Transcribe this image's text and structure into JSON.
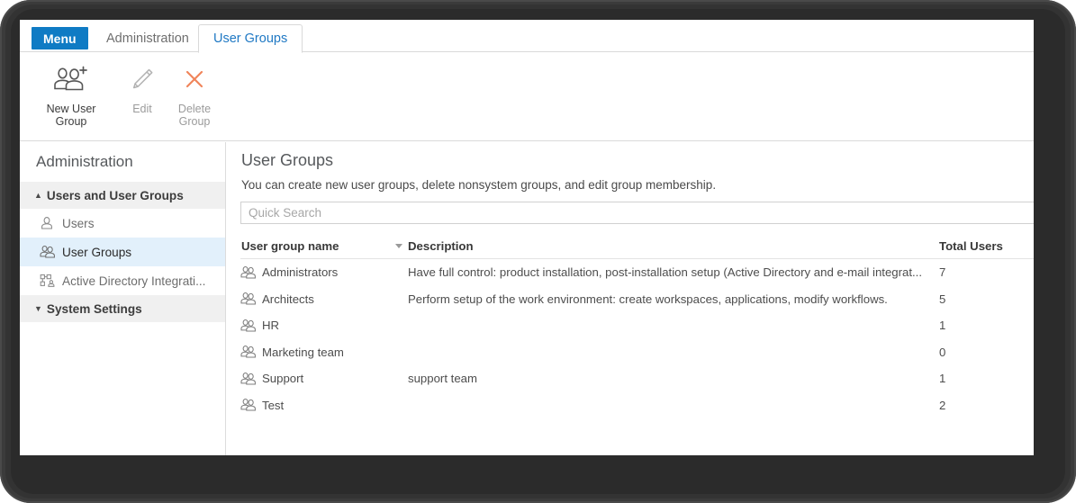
{
  "window": {
    "tabs": [
      {
        "id": "menu",
        "label": "Menu",
        "state": "button"
      },
      {
        "id": "administration",
        "label": "Administration",
        "state": "inactive"
      },
      {
        "id": "usergroups",
        "label": "User Groups",
        "state": "active"
      }
    ]
  },
  "ribbon": {
    "buttons": [
      {
        "id": "new-user-group",
        "label": "New User\nGroup",
        "icon": "add-users-icon",
        "enabled": true
      },
      {
        "id": "edit",
        "label": "Edit",
        "icon": "pencil-icon",
        "enabled": false
      },
      {
        "id": "delete-group",
        "label": "Delete\nGroup",
        "icon": "cross-icon",
        "enabled": false
      }
    ]
  },
  "sidebar": {
    "title": "Administration",
    "groups": [
      {
        "id": "users-and-user-groups",
        "label": "Users and User Groups",
        "chevron": "chevron-up-icon",
        "expanded": true,
        "items": [
          {
            "id": "users",
            "label": "Users",
            "icon": "user-icon",
            "selected": false
          },
          {
            "id": "user-groups",
            "label": "User Groups",
            "icon": "user-group-icon",
            "selected": true
          },
          {
            "id": "active-directory-integration",
            "label": "Active Directory Integrati...",
            "icon": "active-directory-icon",
            "selected": false
          }
        ]
      },
      {
        "id": "system-settings",
        "label": "System Settings",
        "chevron": "chevron-down-icon",
        "expanded": false,
        "items": []
      }
    ]
  },
  "main": {
    "title": "User Groups",
    "subtitle": "You can create new user groups, delete nonsystem groups, and edit group membership.",
    "search": {
      "value": "",
      "placeholder": "Quick Search"
    },
    "table": {
      "columns": [
        "User group name",
        "Description",
        "Total Users"
      ],
      "sort_column": "User group name",
      "sort_direction": "descending",
      "rows": [
        {
          "name": "Administrators",
          "description": "Have full control: product installation, post-installation setup (Active Directory and e-mail integrat...",
          "total_users": "7",
          "icon": "user-group-icon"
        },
        {
          "name": "Architects",
          "description": "Perform setup of the work environment: create workspaces, applications, modify workflows.",
          "total_users": "5",
          "icon": "user-group-icon"
        },
        {
          "name": "HR",
          "description": "",
          "total_users": "1",
          "icon": "user-group-icon"
        },
        {
          "name": "Marketing team",
          "description": "",
          "total_users": "0",
          "icon": "user-group-icon"
        },
        {
          "name": "Support",
          "description": "support team",
          "total_users": "1",
          "icon": "user-group-icon"
        },
        {
          "name": "Test",
          "description": "",
          "total_users": "2",
          "icon": "user-group-icon"
        }
      ]
    }
  },
  "colors": {
    "accent_blue": "#0f7bc4",
    "active_tab_text": "#2079c4",
    "selected_nav_bg": "#e2f0fb",
    "group_header_bg": "#f0f0f0",
    "delete_icon_orange": "#f0845a",
    "bezel": "#3b3b3b"
  }
}
